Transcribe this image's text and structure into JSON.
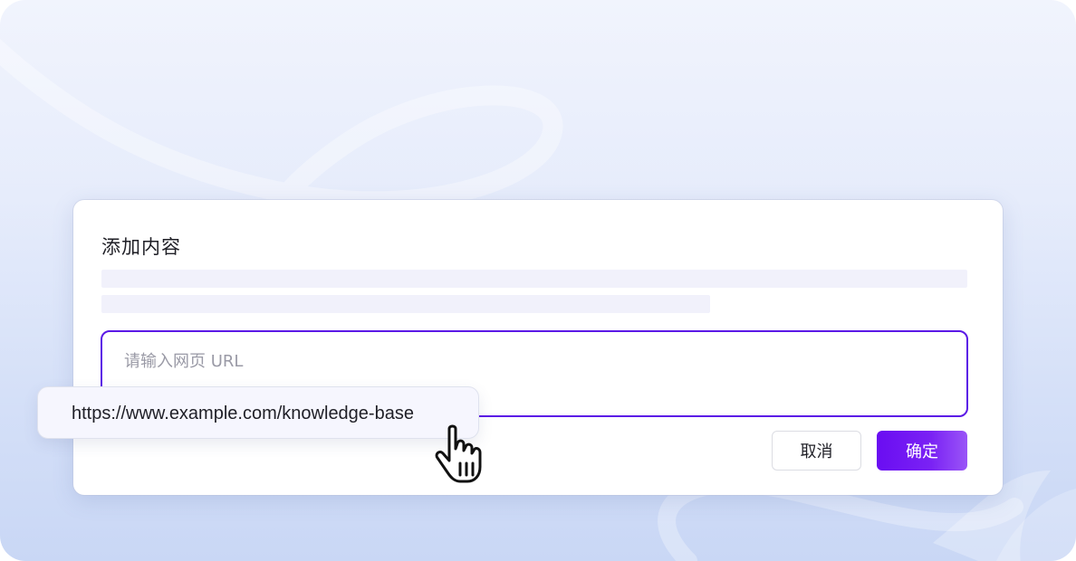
{
  "dialog": {
    "title": "添加内容",
    "input": {
      "placeholder": "请输入网页 URL",
      "value": ""
    },
    "buttons": {
      "cancel_label": "取消",
      "confirm_label": "确定"
    }
  },
  "suggestion": {
    "text": "https://www.example.com/knowledge-base"
  },
  "cursor": {
    "icon": "hand-pointer-icon"
  },
  "colors": {
    "accent": "#5b19e6",
    "confirm_gradient_start": "#6a0df2",
    "confirm_gradient_end": "#9a55f7",
    "background": "#dfe6fa"
  }
}
